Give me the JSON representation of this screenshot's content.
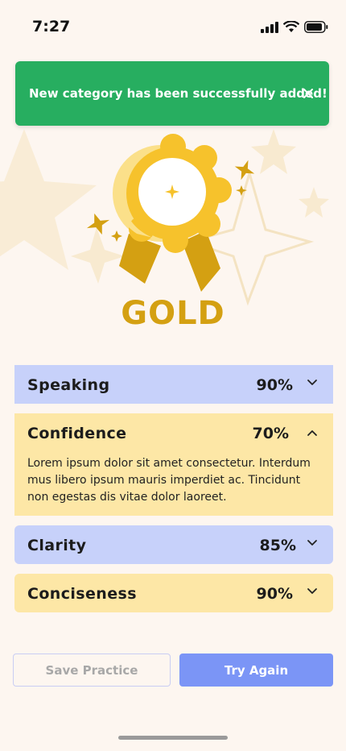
{
  "status_bar": {
    "time": "7:27"
  },
  "toast": {
    "message": "New category has been successfully added!"
  },
  "award": {
    "label": "GOLD"
  },
  "categories": [
    {
      "title": "Speaking",
      "score": "90%",
      "expanded": false
    },
    {
      "title": "Confidence",
      "score": "70%",
      "expanded": true,
      "description": "Lorem ipsum dolor sit amet consectetur. Interdum mus libero ipsum mauris imperdiet ac. Tincidunt non egestas dis vitae dolor laoreet."
    },
    {
      "title": "Clarity",
      "score": "85%",
      "expanded": false
    },
    {
      "title": "Conciseness",
      "score": "90%",
      "expanded": false
    }
  ],
  "actions": {
    "save_label": "Save Practice",
    "try_label": "Try Again"
  },
  "colors": {
    "success": "#27ae60",
    "gold": "#d4a012",
    "blue_card": "#c7d1fa",
    "yellow_card": "#fde7a6",
    "primary": "#7b95f6"
  },
  "icons": [
    "cellular-signal-icon",
    "wifi-icon",
    "battery-icon",
    "close-icon",
    "gold-medal-icon",
    "chevron-down-icon",
    "chevron-up-icon"
  ]
}
